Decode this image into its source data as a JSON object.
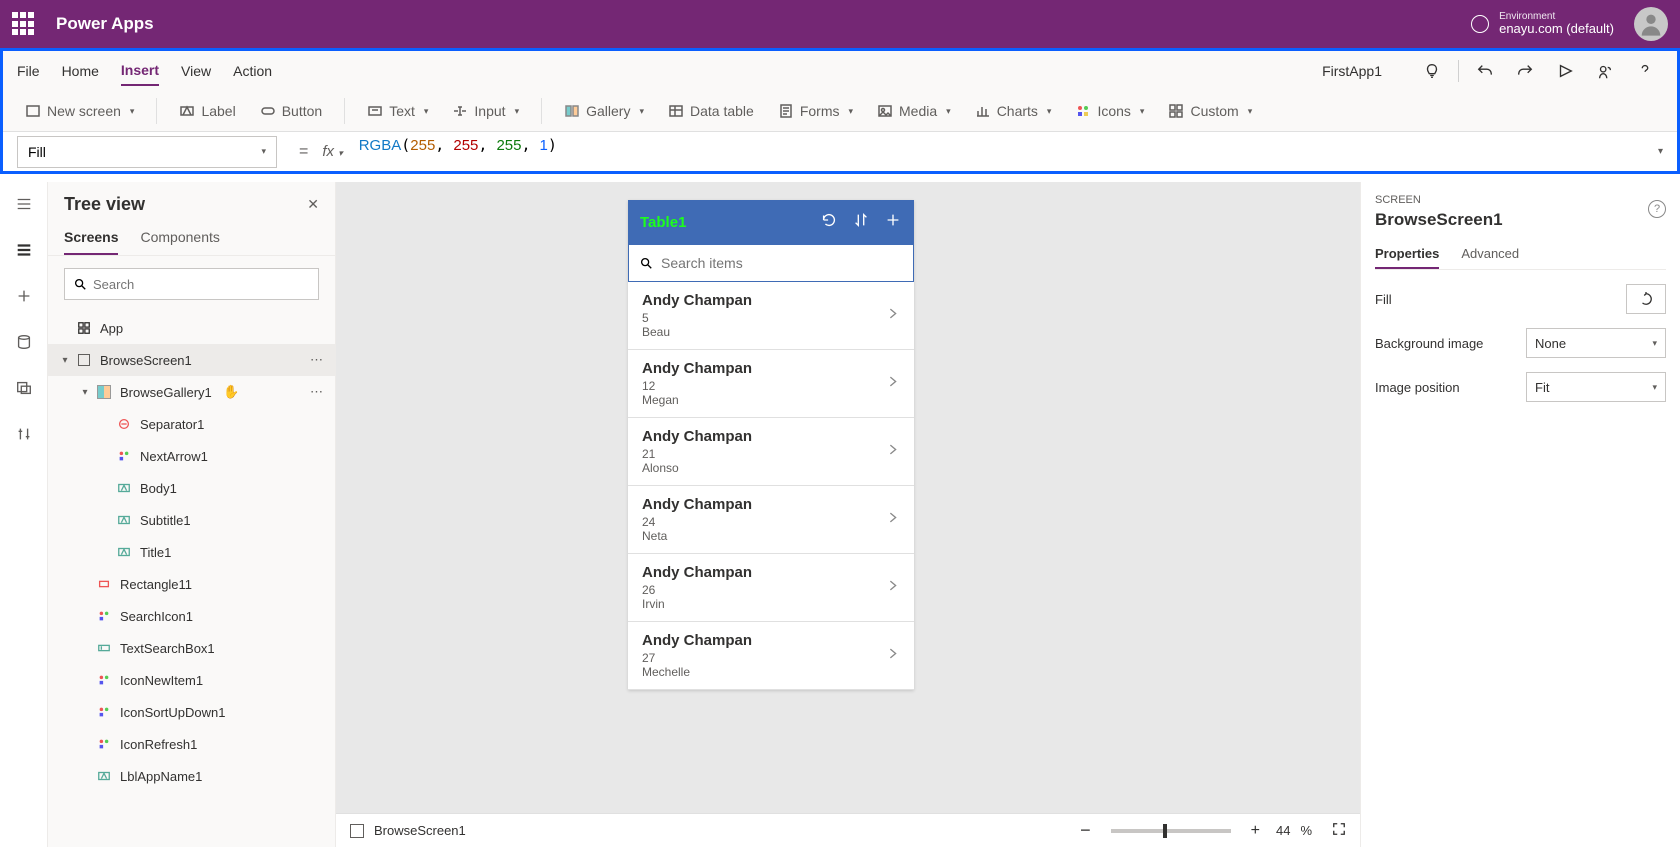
{
  "titlebar": {
    "brand": "Power Apps",
    "env_label": "Environment",
    "env_value": "enayu.com (default)"
  },
  "menubar": {
    "items": [
      "File",
      "Home",
      "Insert",
      "View",
      "Action"
    ],
    "active": "Insert",
    "app_name": "FirstApp1"
  },
  "ribbon": {
    "new_screen": "New screen",
    "label": "Label",
    "button": "Button",
    "text": "Text",
    "input": "Input",
    "gallery": "Gallery",
    "data_table": "Data table",
    "forms": "Forms",
    "media": "Media",
    "charts": "Charts",
    "icons": "Icons",
    "custom": "Custom"
  },
  "formulabar": {
    "property": "Fill",
    "fx": "fx",
    "formula_fn": "RGBA",
    "formula_args": [
      "255",
      "255",
      "255",
      "1"
    ]
  },
  "treeview": {
    "title": "Tree view",
    "tabs": [
      "Screens",
      "Components"
    ],
    "active_tab": "Screens",
    "search_placeholder": "Search",
    "nodes": [
      {
        "label": "App",
        "indent": 0,
        "icon": "app",
        "twist": ""
      },
      {
        "label": "BrowseScreen1",
        "indent": 0,
        "icon": "screen",
        "twist": "▾",
        "sel": true,
        "dots": true
      },
      {
        "label": "BrowseGallery1",
        "indent": 1,
        "icon": "gallery",
        "twist": "▾",
        "dots": true,
        "cursor": true
      },
      {
        "label": "Separator1",
        "indent": 2,
        "icon": "sep"
      },
      {
        "label": "NextArrow1",
        "indent": 2,
        "icon": "iconctl"
      },
      {
        "label": "Body1",
        "indent": 2,
        "icon": "labelctl"
      },
      {
        "label": "Subtitle1",
        "indent": 2,
        "icon": "labelctl"
      },
      {
        "label": "Title1",
        "indent": 2,
        "icon": "labelctl"
      },
      {
        "label": "Rectangle11",
        "indent": 1,
        "icon": "rect"
      },
      {
        "label": "SearchIcon1",
        "indent": 1,
        "icon": "iconctl"
      },
      {
        "label": "TextSearchBox1",
        "indent": 1,
        "icon": "textinput"
      },
      {
        "label": "IconNewItem1",
        "indent": 1,
        "icon": "iconctl"
      },
      {
        "label": "IconSortUpDown1",
        "indent": 1,
        "icon": "iconctl"
      },
      {
        "label": "IconRefresh1",
        "indent": 1,
        "icon": "iconctl"
      },
      {
        "label": "LblAppName1",
        "indent": 1,
        "icon": "labelctl"
      }
    ]
  },
  "phone": {
    "title": "Table1",
    "search_placeholder": "Search items",
    "items": [
      {
        "title": "Andy Champan",
        "sub": "5",
        "body": "Beau"
      },
      {
        "title": "Andy Champan",
        "sub": "12",
        "body": "Megan"
      },
      {
        "title": "Andy Champan",
        "sub": "21",
        "body": "Alonso"
      },
      {
        "title": "Andy Champan",
        "sub": "24",
        "body": "Neta"
      },
      {
        "title": "Andy Champan",
        "sub": "26",
        "body": "Irvin"
      },
      {
        "title": "Andy Champan",
        "sub": "27",
        "body": "Mechelle"
      }
    ]
  },
  "properties": {
    "section": "SCREEN",
    "name": "BrowseScreen1",
    "tabs": [
      "Properties",
      "Advanced"
    ],
    "active_tab": "Properties",
    "rows": {
      "fill": "Fill",
      "bg": "Background image",
      "bg_val": "None",
      "imgpos": "Image position",
      "imgpos_val": "Fit"
    }
  },
  "statusbar": {
    "screen": "BrowseScreen1",
    "zoom": "44",
    "pct": "%",
    "minus": "−",
    "plus": "+"
  }
}
